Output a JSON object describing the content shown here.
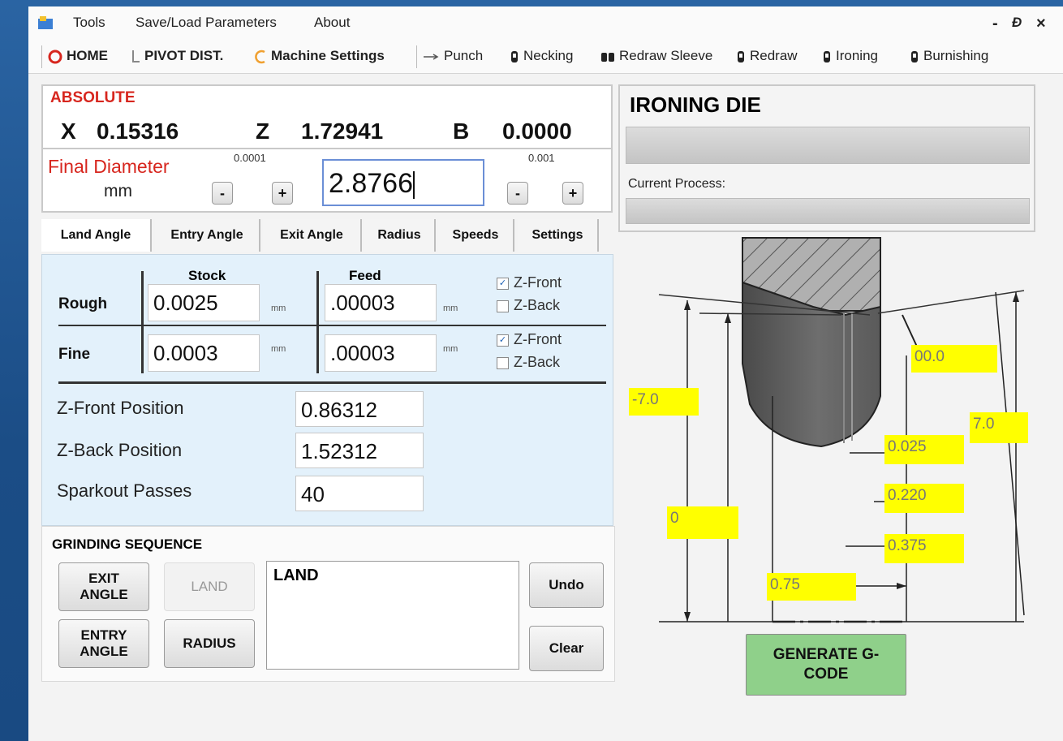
{
  "menu": {
    "tools": "Tools",
    "save_load": "Save/Load Parameters",
    "about": "About"
  },
  "window_controls": {
    "minimize": "-",
    "restore": "Ɖ",
    "close": "×"
  },
  "toolbar": {
    "home": "HOME",
    "pivot": "PIVOT DIST.",
    "machine": "Machine Settings",
    "punch": "Punch",
    "necking": "Necking",
    "redraw_sleeve": "Redraw Sleeve",
    "redraw": "Redraw",
    "ironing": "Ironing",
    "burnishing": "Burnishing"
  },
  "absolute": {
    "title": "ABSOLUTE",
    "x_label": "X",
    "x": "0.15316",
    "z_label": "Z",
    "z": "1.72941",
    "b_label": "B",
    "b": "0.0000"
  },
  "final_diameter": {
    "label": "Final Diameter",
    "unit": "mm",
    "step_small": "0.0001",
    "step_large": "0.001",
    "value": "2.8766",
    "minus": "-",
    "plus": "+"
  },
  "tabs": [
    "Land Angle",
    "Entry Angle",
    "Exit Angle",
    "Radius",
    "Speeds",
    "Settings"
  ],
  "land": {
    "stock_header": "Stock",
    "feed_header": "Feed",
    "rough": {
      "label": "Rough",
      "stock": "0.0025",
      "stock_unit": "mm",
      "feed": ".00003",
      "feed_unit": "mm",
      "z_front": "Z-Front",
      "z_back": "Z-Back",
      "z_front_checked": true,
      "z_back_checked": false
    },
    "fine": {
      "label": "Fine",
      "stock": "0.0003",
      "stock_unit": "mm",
      "feed": ".00003",
      "feed_unit": "mm",
      "z_front": "Z-Front",
      "z_back": "Z-Back",
      "z_front_checked": true,
      "z_back_checked": false
    },
    "z_front_position_label": "Z-Front Position",
    "z_front_position": "0.86312",
    "z_back_position_label": "Z-Back Position",
    "z_back_position": "1.52312",
    "sparkout_label": "Sparkout Passes",
    "sparkout": "40"
  },
  "grinding": {
    "title": "GRINDING SEQUENCE",
    "exit_angle": "EXIT ANGLE",
    "land": "LAND",
    "entry_angle": "ENTRY ANGLE",
    "radius": "RADIUS",
    "sequence_text": "LAND",
    "undo": "Undo",
    "clear": "Clear"
  },
  "ironing": {
    "title": "IRONING DIE",
    "current_process_label": "Current Process:",
    "progress_top": 0,
    "progress_bottom": 0
  },
  "diagram": {
    "angle_right_top": "00.0",
    "angle_left": "-7.0",
    "angle_right": "7.0",
    "dim1": "0.025",
    "dim2": "0.220",
    "dim3": "0.375",
    "zero": "0",
    "width": "0.75"
  },
  "generate_button": "GENERATE G-CODE",
  "colors": {
    "accent_red": "#d7261e",
    "label_yellow": "#ffff00",
    "generate_green": "#8fd08a",
    "panel_blue": "#e3f1fb"
  }
}
